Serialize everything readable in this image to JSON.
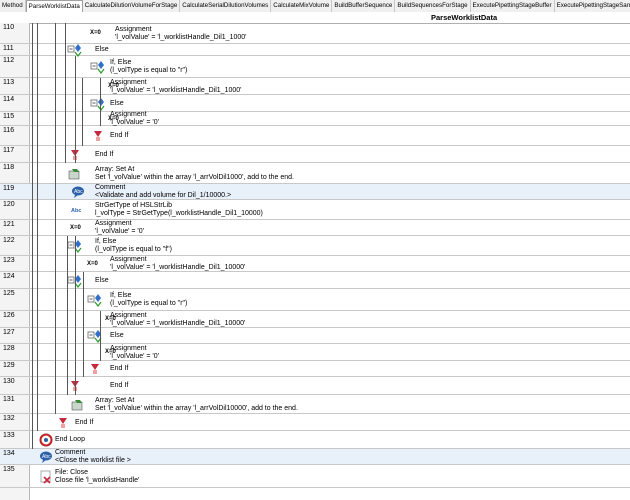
{
  "tabs": [
    "Method",
    "ParseWorklistData",
    "CalculateDilutionVolumeForStage",
    "CalculateSerialDilutionVolumes",
    "CalculateMixVolume",
    "BuildBufferSequence",
    "BuildSequencesForStage",
    "ExecutePipettingStageBuffer",
    "ExecutePipettingStageSample",
    "OnAbort"
  ],
  "active_tab": 1,
  "header_title": "ParseWorklistData",
  "rows": [
    {
      "n": "110",
      "type": "assign",
      "lines": [
        "Assignment",
        "'l_volValue' = 'l_worklistHandle_Dil1_1000'"
      ]
    },
    {
      "n": "111",
      "type": "else",
      "lines": [
        "Else"
      ]
    },
    {
      "n": "112",
      "type": "if",
      "lines": [
        "If, Else",
        "(l_volType is equal to \"r\")"
      ]
    },
    {
      "n": "113",
      "type": "assign",
      "lines": [
        "Assignment",
        "'l_volValue' = 'l_worklistHandle_Dil1_1000'"
      ]
    },
    {
      "n": "114",
      "type": "else",
      "lines": [
        "Else"
      ]
    },
    {
      "n": "115",
      "type": "assign",
      "lines": [
        "Assignment",
        "'l_volValue' = '0'"
      ]
    },
    {
      "n": "116",
      "type": "endif",
      "lines": [
        "End If"
      ]
    },
    {
      "n": "117",
      "type": "endif",
      "lines": [
        "End If"
      ]
    },
    {
      "n": "118",
      "type": "array",
      "lines": [
        "Array: Set At",
        "Set 'l_volValue' within the array 'l_arrVolDil1000', add to the end."
      ]
    },
    {
      "n": "119",
      "type": "comment",
      "lines": [
        "Comment",
        "<Validate and add volume for Dil_1/10000.>"
      ]
    },
    {
      "n": "120",
      "type": "str",
      "lines": [
        "StrGetType of HSLStrLib",
        "l_volType = StrGetType(l_worklistHandle_Dil1_10000)"
      ]
    },
    {
      "n": "121",
      "type": "assign",
      "lines": [
        "Assignment",
        "'l_volValue' = '0'"
      ]
    },
    {
      "n": "122",
      "type": "if",
      "lines": [
        "If, Else",
        "(l_volType is equal to \"f\")"
      ]
    },
    {
      "n": "123",
      "type": "assign",
      "lines": [
        "Assignment",
        "'l_volValue' = 'l_worklistHandle_Dil1_10000'"
      ]
    },
    {
      "n": "124",
      "type": "else",
      "lines": [
        "Else"
      ]
    },
    {
      "n": "125",
      "type": "if",
      "lines": [
        "If, Else",
        "(l_volType is equal to \"r\")"
      ]
    },
    {
      "n": "126",
      "type": "assign",
      "lines": [
        "Assignment",
        "'l_volValue' = 'l_worklistHandle_Dil1_10000'"
      ]
    },
    {
      "n": "127",
      "type": "else",
      "lines": [
        "Else"
      ]
    },
    {
      "n": "128",
      "type": "assign",
      "lines": [
        "Assignment",
        "'l_volValue' = '0'"
      ]
    },
    {
      "n": "129",
      "type": "endif",
      "lines": [
        "End If"
      ]
    },
    {
      "n": "130",
      "type": "endif",
      "lines": [
        "End If"
      ]
    },
    {
      "n": "131",
      "type": "array",
      "lines": [
        "Array: Set At",
        "Set 'l_volValue' within the array 'l_arrVolDil10000', add to the end."
      ]
    },
    {
      "n": "132",
      "type": "endif",
      "lines": [
        "End If"
      ]
    },
    {
      "n": "133",
      "type": "loop",
      "lines": [
        "End Loop"
      ]
    },
    {
      "n": "134",
      "type": "comment",
      "lines": [
        "Comment",
        "<Close the worklist file >"
      ]
    },
    {
      "n": "135",
      "type": "file",
      "lines": [
        "File: Close",
        "Close file 'l_worklistHandle'"
      ]
    }
  ],
  "assign_glyph": "X=0",
  "colors": {
    "highlight": "#e8f0fa",
    "if_blue": "#2f6fc9",
    "end_red": "#c8283c",
    "loop_red": "#c02020",
    "array_green": "#3a8a3a"
  }
}
